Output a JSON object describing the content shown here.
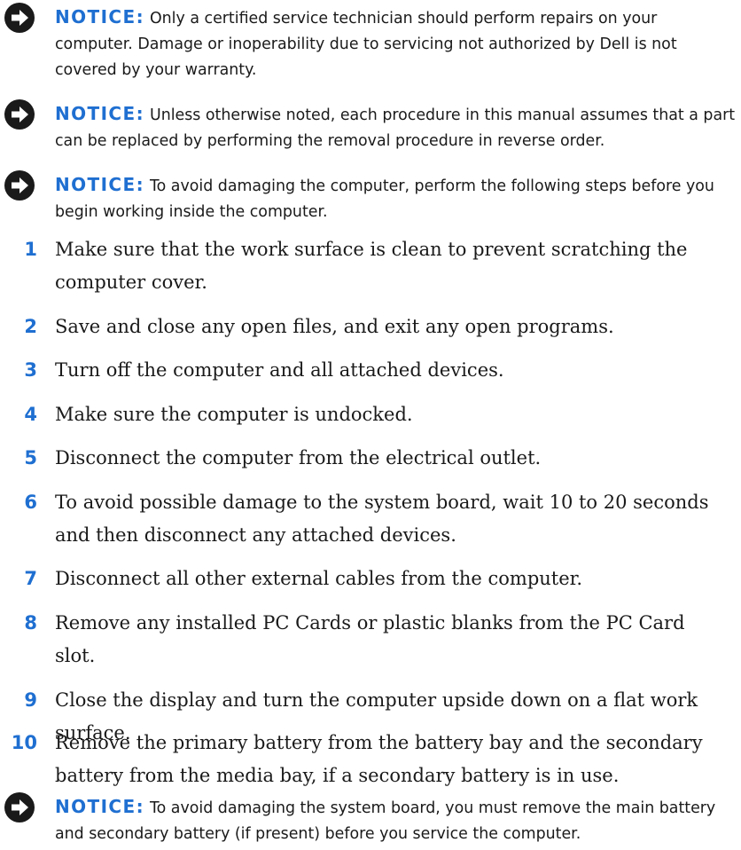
{
  "colors": {
    "accent": "#1f6fd1",
    "text": "#1a1a1a",
    "icon": "#1a1a1a"
  },
  "notices": [
    {
      "icon": "notice-arrow-icon",
      "label": "NOTICE:",
      "text": "Only a certified service technician should perform repairs on your computer. Damage or inoperability due to servicing not authorized by Dell is not covered by your warranty."
    },
    {
      "icon": "notice-arrow-icon",
      "label": "NOTICE:",
      "text": "Unless otherwise noted, each procedure in this manual assumes that a part can be replaced by performing the removal procedure in reverse order."
    },
    {
      "icon": "notice-arrow-icon",
      "label": "NOTICE:",
      "text": "To avoid damaging the computer, perform the following steps before you begin working inside the computer."
    },
    {
      "icon": "notice-arrow-icon",
      "label": "NOTICE:",
      "text": "To avoid damaging the system board, you must remove the main battery and secondary battery (if present) before you service the computer."
    }
  ],
  "steps": [
    {
      "num": "1",
      "text": "Make sure that the work surface is clean to prevent scratching the computer cover."
    },
    {
      "num": "2",
      "text": "Save and close any open files, and exit any open programs."
    },
    {
      "num": "3",
      "text": "Turn off the computer and all attached devices."
    },
    {
      "num": "4",
      "text": "Make sure the computer is undocked."
    },
    {
      "num": "5",
      "text": "Disconnect the computer from the electrical outlet."
    },
    {
      "num": "6",
      "text": "To avoid possible damage to the system board, wait 10 to 20 seconds and then disconnect any attached devices."
    },
    {
      "num": "7",
      "text": "Disconnect all other external cables from the computer."
    },
    {
      "num": "8",
      "text": "Remove any installed PC Cards or plastic blanks from the PC Card slot."
    },
    {
      "num": "9",
      "text": "Close the display and turn the computer upside down on a flat work surface."
    },
    {
      "num": "10",
      "text": "Remove the primary battery from the battery bay and the secondary battery from the media bay, if a secondary battery is in use."
    }
  ]
}
